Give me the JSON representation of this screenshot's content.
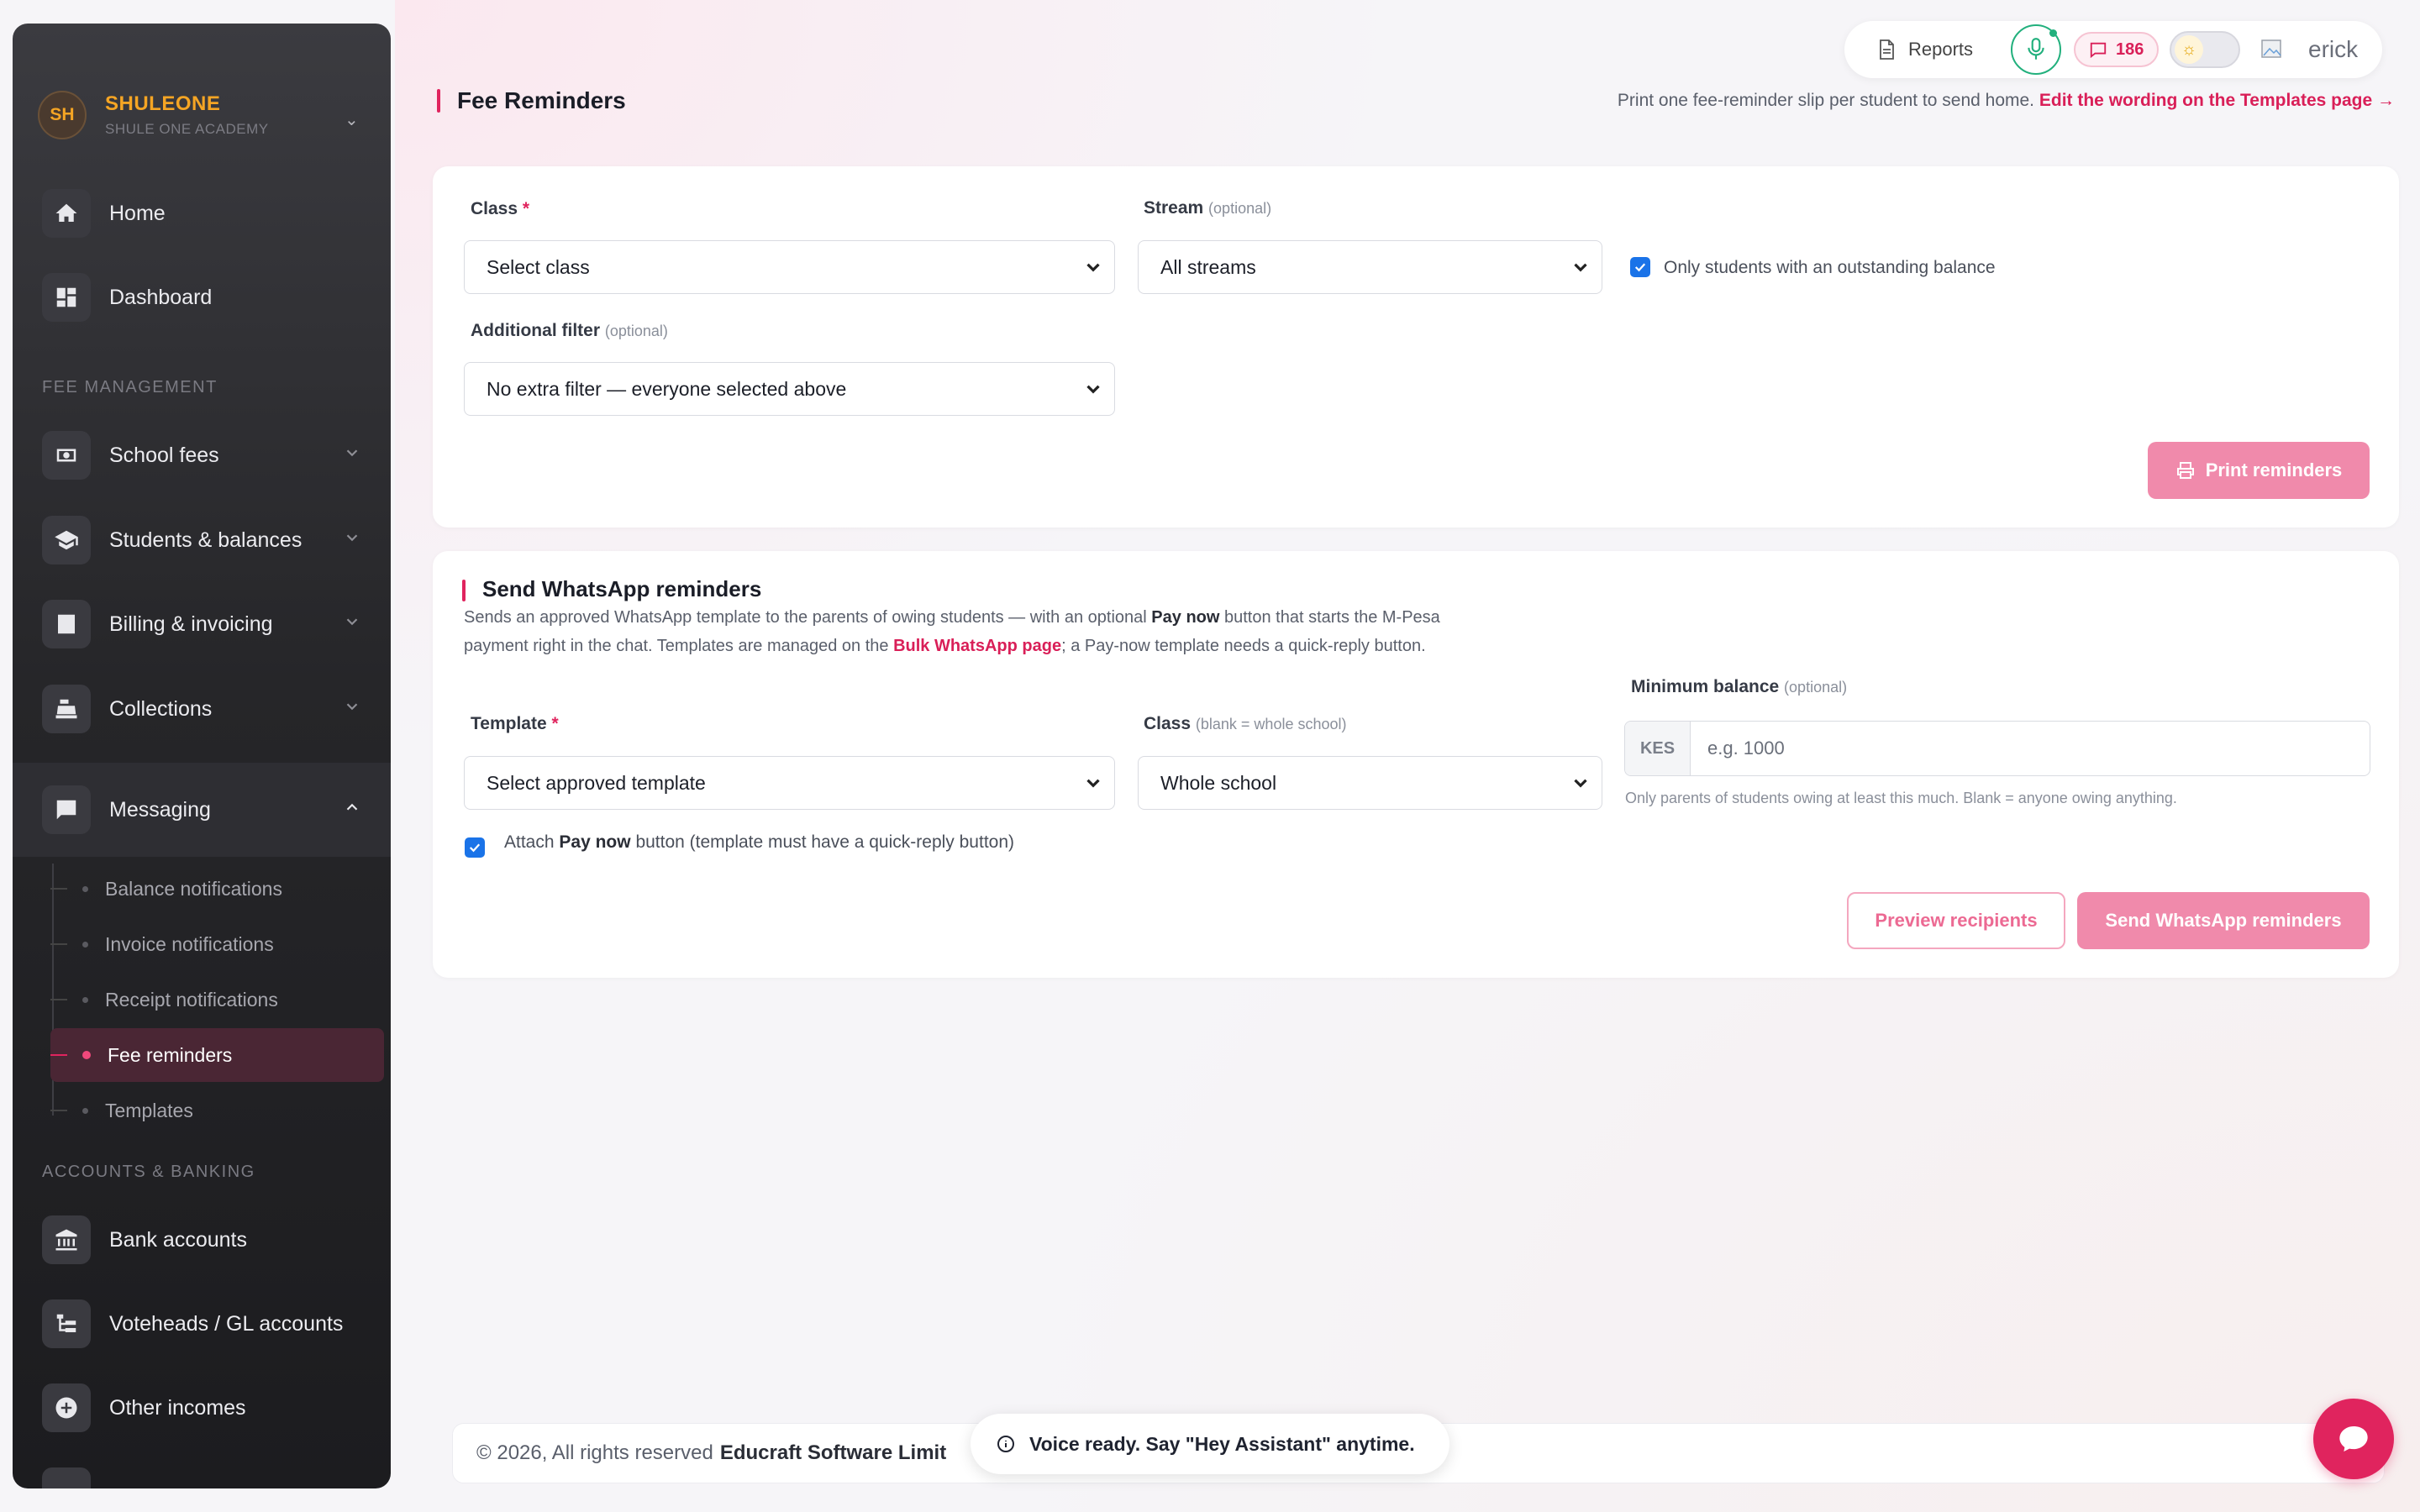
{
  "brand": {
    "initials": "SH",
    "name": "SHULEONE",
    "subtitle": "SHULE ONE ACADEMY"
  },
  "sidebar": {
    "top_items": [
      {
        "label": "Home",
        "icon": "home-icon"
      },
      {
        "label": "Dashboard",
        "icon": "dashboard-icon"
      }
    ],
    "sections": [
      {
        "title": "FEE MANAGEMENT",
        "items": [
          {
            "label": "School fees",
            "icon": "money-icon"
          },
          {
            "label": "Students & balances",
            "icon": "graduation-cap-icon"
          },
          {
            "label": "Billing & invoicing",
            "icon": "invoice-icon"
          },
          {
            "label": "Collections",
            "icon": "cash-register-icon"
          },
          {
            "label": "Messaging",
            "icon": "message-icon",
            "expanded": true
          }
        ]
      },
      {
        "title": "ACCOUNTS & BANKING",
        "items": [
          {
            "label": "Bank accounts",
            "icon": "bank-icon"
          },
          {
            "label": "Voteheads / GL accounts",
            "icon": "tree-icon"
          },
          {
            "label": "Other incomes",
            "icon": "plus-circle-icon"
          }
        ]
      }
    ],
    "messaging_sub": [
      {
        "label": "Balance notifications"
      },
      {
        "label": "Invoice notifications"
      },
      {
        "label": "Receipt notifications"
      },
      {
        "label": "Fee reminders",
        "active": true
      },
      {
        "label": "Templates"
      }
    ]
  },
  "topbar": {
    "reports": "Reports",
    "badge_count": "186",
    "user": "erick"
  },
  "page": {
    "title": "Fee Reminders",
    "hint": "Print one fee-reminder slip per student to send home.",
    "hint_link": "Edit the wording on the Templates page →"
  },
  "print_form": {
    "class_label": "Class",
    "class_req": "*",
    "class_value": "Select class",
    "stream_label": "Stream",
    "stream_opt": "(optional)",
    "stream_value": "All streams",
    "only_outstanding": "Only students with an outstanding balance",
    "filter_label": "Additional filter",
    "filter_opt": "(optional)",
    "filter_value": "No extra filter — everyone selected above",
    "print_button": "Print reminders"
  },
  "whatsapp": {
    "title": "Send WhatsApp reminders",
    "desc_1": "Sends an approved WhatsApp template to the parents of owing students — with an optional",
    "desc_pay": "Pay now",
    "desc_2": "button that starts the M-Pesa payment right in the chat. Templates are managed on the",
    "desc_link": "Bulk WhatsApp page",
    "desc_3": "; a Pay-now template needs a quick-reply button.",
    "template_label": "Template",
    "template_req": "*",
    "template_value": "Select approved template",
    "class_label": "Class",
    "class_opt": "(blank = whole school)",
    "class_value": "Whole school",
    "min_label": "Minimum balance",
    "min_opt": "(optional)",
    "currency": "KES",
    "min_placeholder": "e.g. 1000",
    "min_help": "Only parents of students owing at least this much. Blank = anyone owing anything.",
    "attach_1": "Attach",
    "attach_pay": "Pay now",
    "attach_2": "button (template must have a quick-reply button)",
    "preview_button": "Preview recipients",
    "send_button": "Send WhatsApp reminders"
  },
  "footer": {
    "text": "© 2026, All rights reserved",
    "company": "Educraft Software Limit"
  },
  "toast": "Voice ready. Say \"Hey Assistant\" anytime.",
  "colors": {
    "accent": "#e0245e",
    "brand": "#f5a524",
    "success": "#22b07d",
    "checkbox": "#1a73e8"
  }
}
